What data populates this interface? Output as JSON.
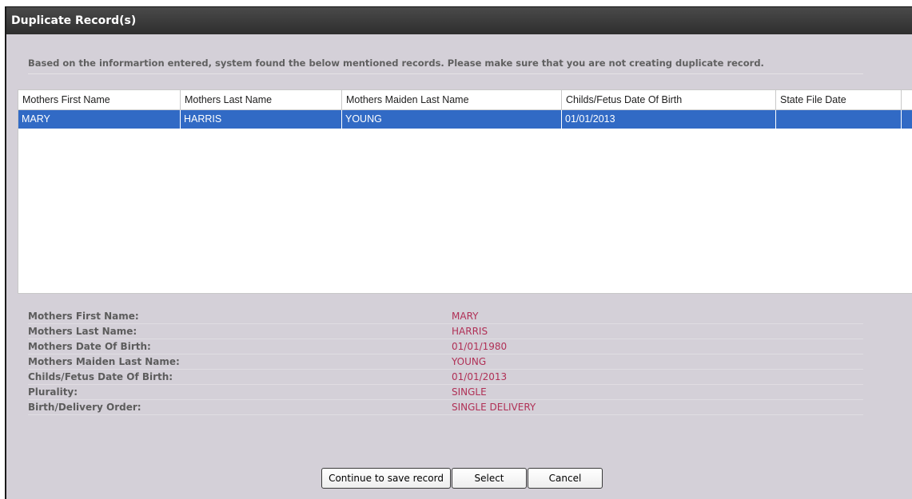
{
  "window": {
    "title": "Duplicate Record(s)"
  },
  "notice": "Based on the informartion entered, system found the below mentioned records. Please make sure that you are not creating duplicate record.",
  "grid": {
    "columns": [
      "Mothers First Name",
      "Mothers Last Name",
      "Mothers Maiden Last Name",
      "Childs/Fetus Date Of Birth",
      "State File Date"
    ],
    "rows": [
      [
        "MARY",
        "HARRIS",
        "YOUNG",
        "01/01/2013",
        ""
      ]
    ],
    "selected_row": 0,
    "selected_color": "#316ac5"
  },
  "details": [
    {
      "label": "Mothers First Name:",
      "value": "MARY"
    },
    {
      "label": "Mothers Last Name:",
      "value": "HARRIS"
    },
    {
      "label": "Mothers Date Of Birth:",
      "value": "01/01/1980"
    },
    {
      "label": "Mothers Maiden Last Name:",
      "value": "YOUNG"
    },
    {
      "label": "Childs/Fetus Date Of Birth:",
      "value": "01/01/2013"
    },
    {
      "label": "Plurality:",
      "value": "SINGLE"
    },
    {
      "label": "Birth/Delivery Order:",
      "value": "SINGLE DELIVERY"
    }
  ],
  "buttons": {
    "continue": "Continue to save record",
    "select": "Select",
    "cancel": "Cancel"
  },
  "colors": {
    "title_bar": "#2e2e2e",
    "dialog_bg": "#d4d0d8",
    "detail_value": "#b03056"
  }
}
